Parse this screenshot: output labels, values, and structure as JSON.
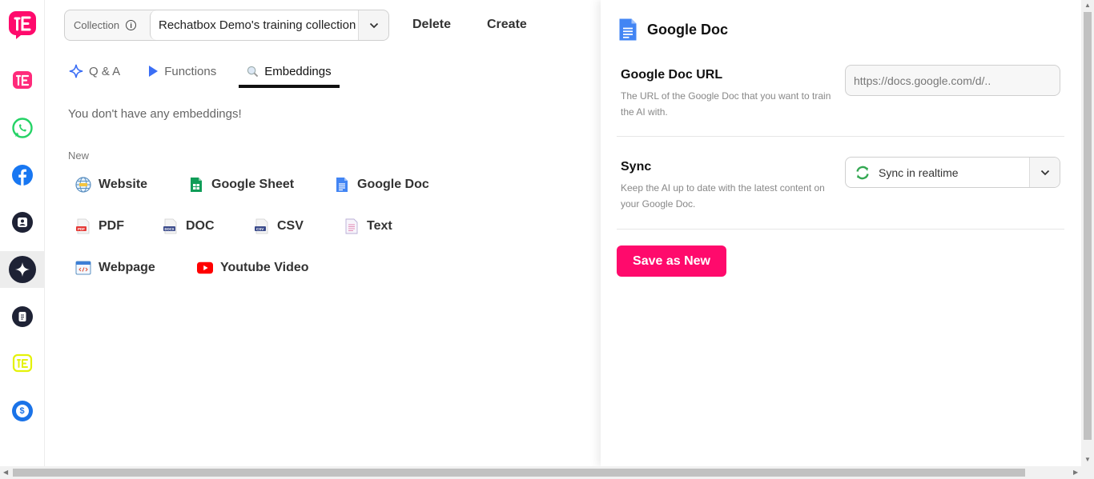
{
  "sidebar": {
    "items": [
      {
        "name": "rechatbox-logo",
        "active": false
      },
      {
        "name": "rechatbox-icon",
        "active": false
      },
      {
        "name": "whatsapp-icon",
        "active": false
      },
      {
        "name": "facebook-icon",
        "active": false
      },
      {
        "name": "contacts-icon",
        "active": false
      },
      {
        "name": "ai-sparkle-icon",
        "active": true
      },
      {
        "name": "document-icon",
        "active": false
      },
      {
        "name": "rechatbox-yellow-icon",
        "active": false
      },
      {
        "name": "billing-dollar-icon",
        "active": false
      }
    ]
  },
  "toolbar": {
    "collection_label": "Collection",
    "collection_value": "Rechatbox Demo's training collection",
    "delete_label": "Delete",
    "create_label": "Create"
  },
  "tabs": [
    {
      "label": "Q & A",
      "icon": "sparkle-icon"
    },
    {
      "label": "Functions",
      "icon": "play-icon"
    },
    {
      "label": "Embeddings",
      "icon": "search-icon",
      "active": true
    }
  ],
  "content": {
    "empty_message": "You don't have any embeddings!",
    "new_label": "New",
    "embeddings": [
      {
        "label": "Website"
      },
      {
        "label": "Google Sheet"
      },
      {
        "label": "Google Doc"
      },
      {
        "label": "PDF"
      },
      {
        "label": "DOC"
      },
      {
        "label": "CSV"
      },
      {
        "label": "Text"
      },
      {
        "label": "Webpage"
      },
      {
        "label": "Youtube Video"
      }
    ]
  },
  "panel": {
    "title": "Google Doc",
    "url_label": "Google Doc URL",
    "url_desc": "The URL of the Google Doc that you want to train the AI with.",
    "url_placeholder": "https://docs.google.com/d/..",
    "sync_label": "Sync",
    "sync_desc": "Keep the AI up to date with the latest content on your Google Doc.",
    "sync_value": "Sync in realtime",
    "save_label": "Save as New"
  },
  "colors": {
    "brand": "#ff0a6c",
    "google_doc_blue": "#4285f4",
    "sheet_green": "#0f9d58"
  }
}
